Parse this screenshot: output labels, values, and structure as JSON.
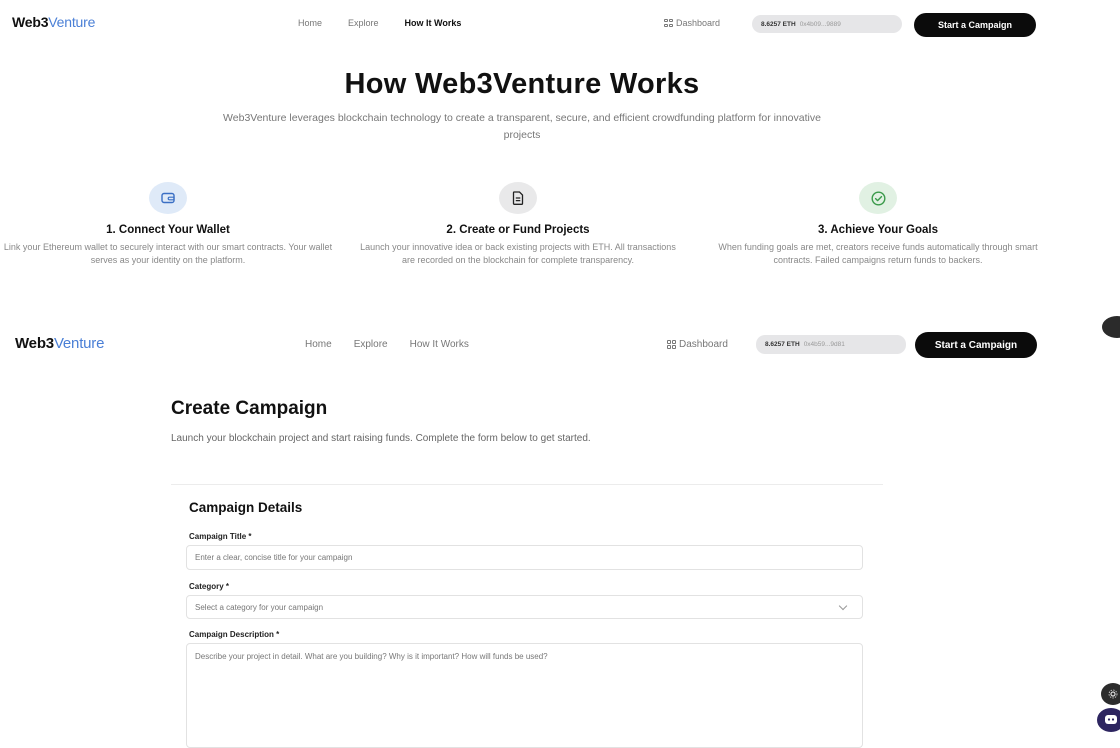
{
  "brand": {
    "part1": "Web3",
    "part2": "Venture"
  },
  "nav_top": {
    "links": [
      "Home",
      "Explore",
      "How It Works"
    ],
    "dashboard": "Dashboard",
    "balance": "8.6257 ETH",
    "address": "0x4b09...9889",
    "cta": "Start a Campaign"
  },
  "hero": {
    "title": "How Web3Venture Works",
    "subtitle": "Web3Venture leverages blockchain technology to create a transparent, secure, and efficient crowdfunding platform for innovative projects"
  },
  "steps": [
    {
      "icon": "wallet-icon",
      "title": "1. Connect Your Wallet",
      "desc": "Link your Ethereum wallet to securely interact with our smart contracts. Your wallet serves as your identity on the platform."
    },
    {
      "icon": "document-icon",
      "title": "2. Create or Fund Projects",
      "desc": "Launch your innovative idea or back existing projects with ETH. All transactions are recorded on the blockchain for complete transparency."
    },
    {
      "icon": "check-circle-icon",
      "title": "3. Achieve Your Goals",
      "desc": "When funding goals are met, creators receive funds automatically through smart contracts. Failed campaigns return funds to backers."
    }
  ],
  "nav_second": {
    "links": [
      "Home",
      "Explore",
      "How It Works"
    ],
    "dashboard": "Dashboard",
    "balance": "8.6257 ETH",
    "address": "0x4b59...9d81",
    "cta": "Start a Campaign"
  },
  "create": {
    "title": "Create Campaign",
    "subtitle": "Launch your blockchain project and start raising funds. Complete the form below to get started.",
    "section_title": "Campaign Details",
    "fields": {
      "title_label": "Campaign Title *",
      "title_placeholder": "Enter a clear, concise title for your campaign",
      "category_label": "Category *",
      "category_placeholder": "Select a category for your campaign",
      "description_label": "Campaign Description *",
      "description_placeholder": "Describe your project in detail. What are you building? Why is it important? How will funds be used?"
    }
  },
  "colors": {
    "accent_blue": "#4a7fd6",
    "cta_bg": "#0b0b0b",
    "wallet_pill": "#e6e6e8"
  }
}
